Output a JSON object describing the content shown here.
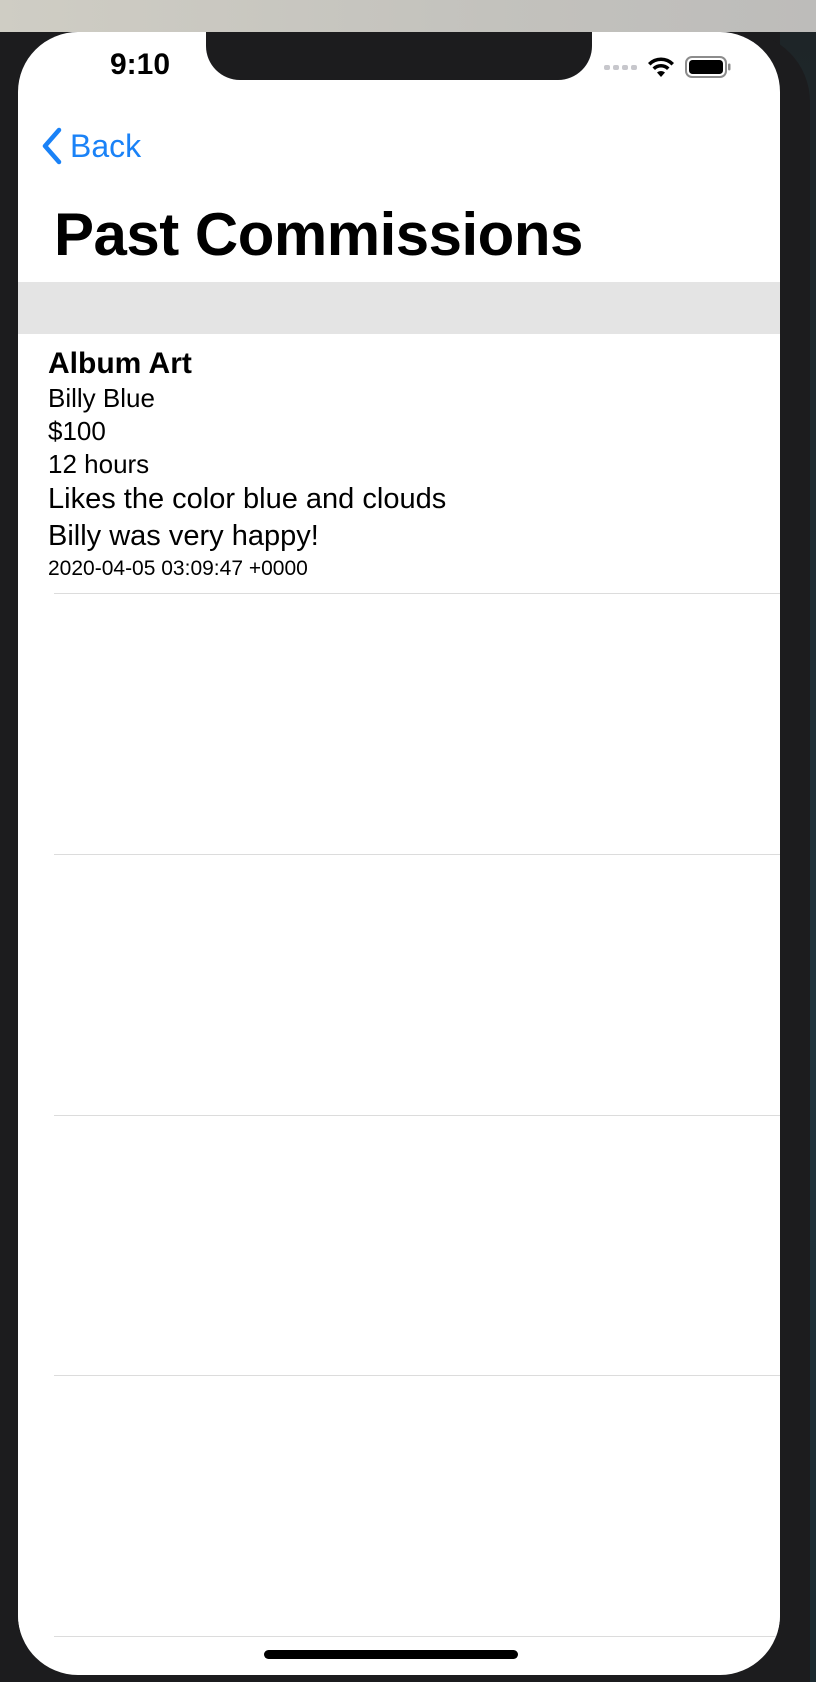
{
  "status_bar": {
    "time": "9:10",
    "signal_icon": "signal-dots-icon",
    "wifi_icon": "wifi-icon",
    "battery_icon": "battery-icon"
  },
  "nav": {
    "back_label": "Back",
    "back_icon": "chevron-left-icon",
    "title": "Past Commissions",
    "accent_color": "#1a82f7"
  },
  "commissions": [
    {
      "title": "Album Art",
      "client": "Billy Blue",
      "price": "$100",
      "hours": "12 hours",
      "notes": "Likes the color blue and clouds",
      "feedback": "Billy was very happy!",
      "date": "2020-04-05 03:09:47 +0000"
    }
  ],
  "colors": {
    "section_header": "#e4e4e4",
    "separator": "#dcdcdc",
    "background": "#ffffff"
  }
}
